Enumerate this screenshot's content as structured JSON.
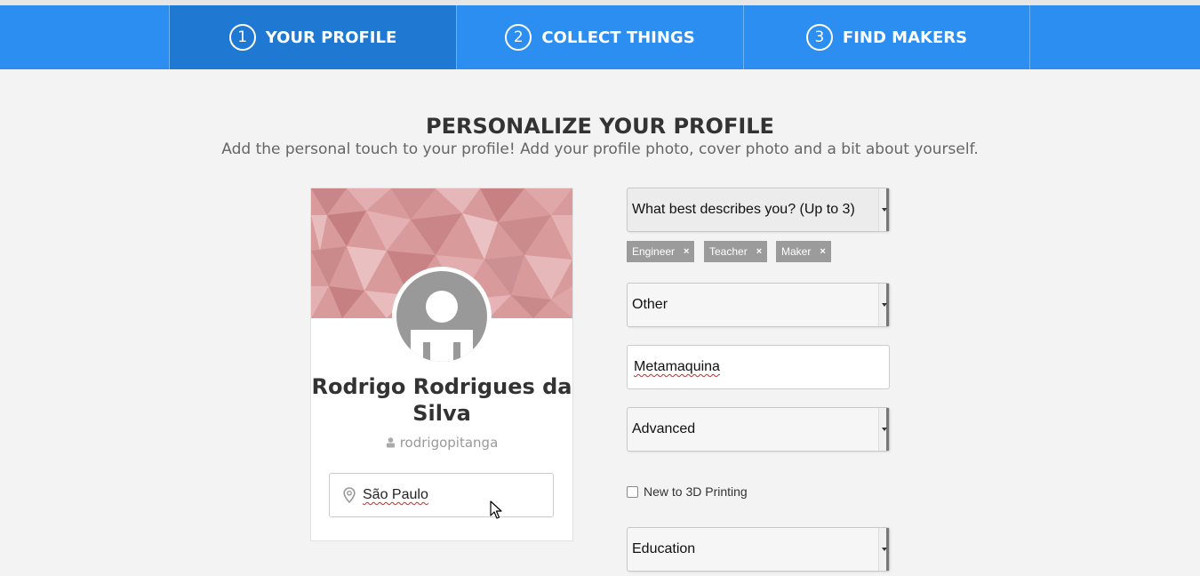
{
  "steps": [
    {
      "num": "1",
      "label": "YOUR PROFILE",
      "active": true
    },
    {
      "num": "2",
      "label": "COLLECT THINGS",
      "active": false
    },
    {
      "num": "3",
      "label": "FIND MAKERS",
      "active": false
    }
  ],
  "page": {
    "title": "PERSONALIZE YOUR PROFILE",
    "subtitle": "Add the personal touch to your profile! Add your profile photo, cover photo and a bit about yourself."
  },
  "profile": {
    "name": "Rodrigo Rodrigues da Silva",
    "username": "rodrigopitanga",
    "location": "São Paulo"
  },
  "form": {
    "describes_label": "What best describes you? (Up to 3)",
    "tags": [
      "Engineer",
      "Teacher",
      "Maker"
    ],
    "tag_remove": "×",
    "occupation": "Other",
    "company": "Metamaquina",
    "skill_level": "Advanced",
    "new_to_3d_label": "New to 3D Printing",
    "industry": "Education"
  },
  "colors": {
    "stepbar": "#2b8ef0",
    "step_active": "#1f79d2",
    "tag_bg": "#9b9b9b"
  }
}
